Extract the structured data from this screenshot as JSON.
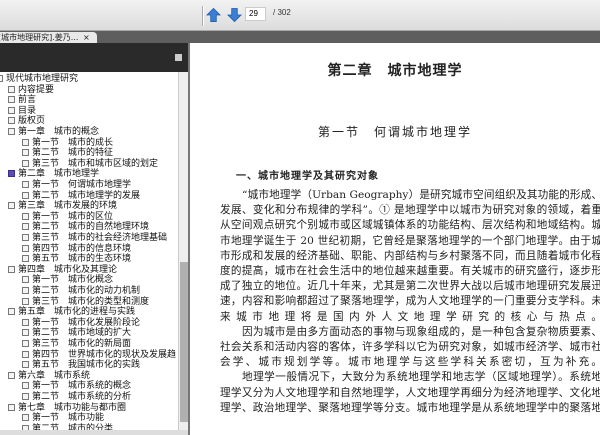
{
  "toolbar": {
    "page_current": "29",
    "page_total": "/ 302"
  },
  "tab": {
    "title": "[城市地理研究].姜乃...",
    "close": "×"
  },
  "outline": [
    {
      "level": 0,
      "label": "现代城市地理研究"
    },
    {
      "level": 1,
      "label": "内容提要"
    },
    {
      "level": 1,
      "label": "前言"
    },
    {
      "level": 1,
      "label": "目录"
    },
    {
      "level": 1,
      "label": "版权页"
    },
    {
      "level": 1,
      "label": "第一章　城市的概念"
    },
    {
      "level": 2,
      "label": "第一节　城市的成长"
    },
    {
      "level": 2,
      "label": "第二节　城市的特征"
    },
    {
      "level": 2,
      "label": "第三节　城市和城市区域的划定"
    },
    {
      "level": 1,
      "label": "第二章　城市地理学",
      "selected": true
    },
    {
      "level": 2,
      "label": "第一节　何谓城市地理学"
    },
    {
      "level": 2,
      "label": "第二节　城市地理学的发展"
    },
    {
      "level": 1,
      "label": "第三章　城市发展的环境"
    },
    {
      "level": 2,
      "label": "第一节　城市的区位"
    },
    {
      "level": 2,
      "label": "第二节　城市的自然地理环境"
    },
    {
      "level": 2,
      "label": "第三节　城市的社会经济地理基础"
    },
    {
      "level": 2,
      "label": "第四节　城市的信息环境"
    },
    {
      "level": 2,
      "label": "第五节　城市的生态环境"
    },
    {
      "level": 1,
      "label": "第四章　城市化及其理论"
    },
    {
      "level": 2,
      "label": "第一节　城市化概念"
    },
    {
      "level": 2,
      "label": "第二节　城市化的动力机制"
    },
    {
      "level": 2,
      "label": "第三节　城市化的类型和测度"
    },
    {
      "level": 1,
      "label": "第五章　城市化的进程与实践"
    },
    {
      "level": 2,
      "label": "第一节　城市化发展阶段论"
    },
    {
      "level": 2,
      "label": "第二节　城市地域的扩大"
    },
    {
      "level": 2,
      "label": "第三节　城市化的新局面"
    },
    {
      "level": 2,
      "label": "第四节　世界城市化的现状及发展趋"
    },
    {
      "level": 2,
      "label": "第五节　我国城市化的实践"
    },
    {
      "level": 1,
      "label": "第六章　城市系统"
    },
    {
      "level": 2,
      "label": "第一节　城市系统的概念"
    },
    {
      "level": 2,
      "label": "第二节　城市系统的分析"
    },
    {
      "level": 1,
      "label": "第七章　城市功能与都市圈"
    },
    {
      "level": 2,
      "label": "第一节　城市功能"
    },
    {
      "level": 2,
      "label": "第二节　城市的分类"
    }
  ],
  "document": {
    "chapter": "第二章　城市地理学",
    "section": "第一节　何谓城市地理学",
    "subheading": "一、城市地理学及其研究对象",
    "lines": [
      {
        "indent": true,
        "text": "“城市地理学（Urban Geography）是研究城市空间组织及其功能的形成、"
      },
      {
        "indent": false,
        "text": "发展、变化和分布规律的学科”。① 是地理学中以城市为研究对象的领域，着重"
      },
      {
        "indent": false,
        "text": "从空间观点研究个别城市或区域城镇体系的功能结构、层次结构和地域结构。城"
      },
      {
        "indent": false,
        "text": "市地理学诞生于 20 世纪初期，它曾经是聚落地理学的一个部门地理学。由于城"
      },
      {
        "indent": false,
        "text": "市形成和发展的经济基础、职能、内部结构与乡村聚落不同，而且随着城市化程"
      },
      {
        "indent": false,
        "text": "度的提高，城市在社会生活中的地位越来越重要。有关城市的研究盛行，逐步形"
      },
      {
        "indent": false,
        "text": "成了独立的地位。近几十年来，尤其是第二次世界大战以后城市地理研究发展迅"
      },
      {
        "indent": false,
        "text": "速，内容和影响都超过了聚落地理学，成为人文地理学的一门重要分支学科。未"
      },
      {
        "indent": false,
        "text": "来城市地理将是国内外人文地理学研究的核心与热点。"
      },
      {
        "indent": true,
        "text": "因为城市是由多方面动态的事物与现象组成的，是一种包含复杂物质要素、"
      },
      {
        "indent": false,
        "text": "社会关系和活动内容的客体，许多学科以它为研究对象，如城市经济学、城市社"
      },
      {
        "indent": false,
        "text": "会学、城市规划学等。城市地理学与这些学科关系密切，互为补充。"
      },
      {
        "indent": true,
        "text": "地理学一般情况下，大致分为系统地理学和地志学（区域地理学）。系统地"
      },
      {
        "indent": false,
        "text": "理学又分为人文地理学和自然地理学，人文地理学再细分为经济地理学、文化地"
      },
      {
        "indent": false,
        "text": "理学、政治地理学、聚落地理学等分支。城市地理学是从系统地理学中的聚落地"
      }
    ]
  }
}
